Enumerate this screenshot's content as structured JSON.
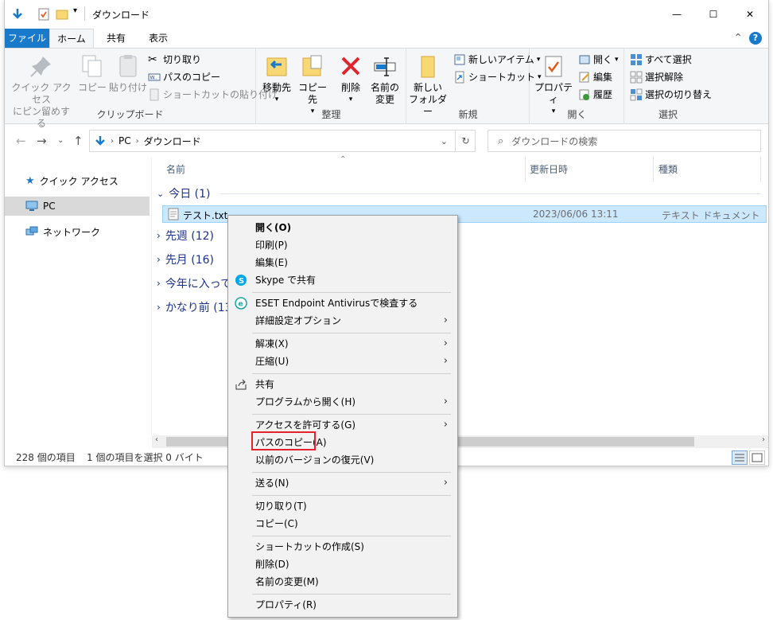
{
  "window": {
    "title": "ダウンロード",
    "controls": {
      "minimize": "—",
      "maximize": "☐",
      "close": "✕"
    }
  },
  "tabs": {
    "file": "ファイル",
    "home": "ホーム",
    "share": "共有",
    "view": "表示"
  },
  "ribbon": {
    "clipboard": {
      "label": "クリップボード",
      "pin_line1": "クイック アクセス",
      "pin_line2": "にピン留めする",
      "copy": "コピー",
      "paste": "貼り付け",
      "cut": "切り取り",
      "copy_path": "パスのコピー",
      "paste_shortcut": "ショートカットの貼り付け"
    },
    "organize": {
      "label": "整理",
      "move_to": "移動先",
      "copy_to": "コピー先",
      "delete": "削除",
      "rename_line1": "名前の",
      "rename_line2": "変更"
    },
    "new": {
      "label": "新規",
      "new_folder_line1": "新しい",
      "new_folder_line2": "フォルダー",
      "new_item": "新しいアイテム",
      "shortcut": "ショートカット"
    },
    "open": {
      "label": "開く",
      "properties": "プロパティ",
      "open": "開く",
      "edit": "編集",
      "history": "履歴"
    },
    "select": {
      "label": "選択",
      "select_all": "すべて選択",
      "select_none": "選択解除",
      "invert": "選択の切り替え"
    }
  },
  "address": {
    "crumbs": [
      "PC",
      "ダウンロード"
    ],
    "search_placeholder": "ダウンロードの検索"
  },
  "nav": {
    "items": [
      {
        "label": "クイック アクセス"
      },
      {
        "label": "PC"
      },
      {
        "label": "ネットワーク"
      }
    ]
  },
  "list": {
    "columns": {
      "name": "名前",
      "modified": "更新日時",
      "type": "種類"
    },
    "groups": [
      {
        "label": "今日 (1)"
      },
      {
        "label": "先週 (12)"
      },
      {
        "label": "先月 (16)"
      },
      {
        "label": "今年に入って"
      },
      {
        "label": "かなり前 (13"
      }
    ],
    "file": {
      "name": "テスト.txt",
      "modified": "2023/06/06 13:11",
      "type": "テキスト ドキュメント"
    }
  },
  "status": {
    "count": "228 個の項目",
    "selected": "1 個の項目を選択  0 バイト"
  },
  "context_menu": {
    "items": [
      "開く(O)",
      "印刷(P)",
      "編集(E)",
      "Skype で共有",
      "ESET Endpoint Antivirusで検査する",
      "詳細設定オプション",
      "解凍(X)",
      "圧縮(U)",
      "共有",
      "プログラムから開く(H)",
      "アクセスを許可する(G)",
      "パスのコピー(A)",
      "以前のバージョンの復元(V)",
      "送る(N)",
      "切り取り(T)",
      "コピー(C)",
      "ショートカットの作成(S)",
      "削除(D)",
      "名前の変更(M)",
      "プロパティ(R)"
    ]
  },
  "colors": {
    "accent": "#1979ca",
    "selection": "#cce8ff",
    "highlight": "#e5212b"
  }
}
